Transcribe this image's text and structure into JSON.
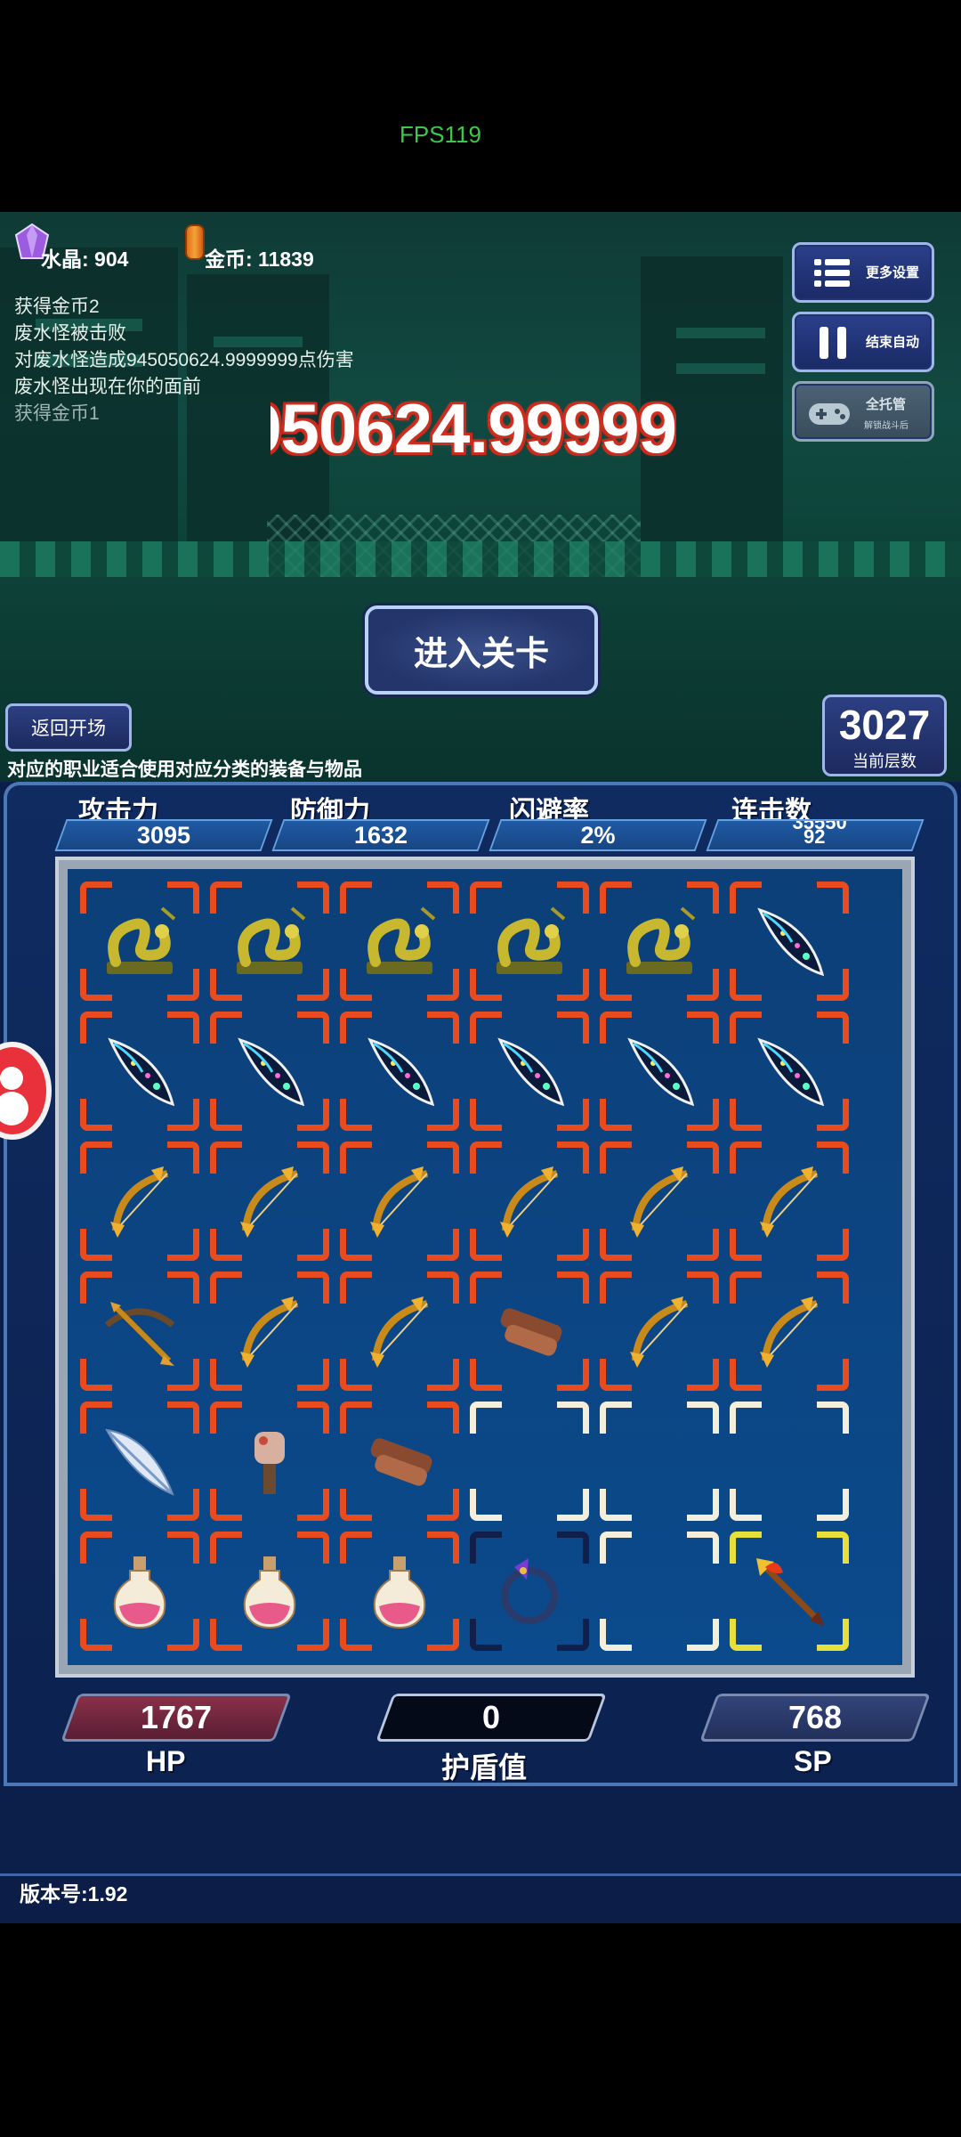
{
  "fps": "FPS119",
  "resources": {
    "crystal_label": "水晶: 904",
    "gold_label": "金币: 11839"
  },
  "battle_log": [
    "获得金币2",
    "废水怪被击败",
    "对废水怪造成945050624.9999999点伤害",
    "废水怪出现在你的面前",
    "获得金币1"
  ],
  "damage_popup": "950624.99999",
  "side_buttons": {
    "more_settings": "更多设置",
    "end_auto": "结束自动",
    "auto_play": "全托管",
    "auto_play_sub": "解锁战斗后"
  },
  "enter_level": "进入关卡",
  "back_to_start": "返回开场",
  "floor": {
    "value": "3027",
    "caption": "当前层数"
  },
  "hint": "对应的职业适合使用对应分类的装备与物品",
  "stats": {
    "attack": {
      "label": "攻击力",
      "value": "3095"
    },
    "defense": {
      "label": "防御力",
      "value": "1632"
    },
    "dodge": {
      "label": "闪避率",
      "value": "2%"
    },
    "combo": {
      "label": "连击数",
      "value_top": "35550",
      "value_bottom": "92"
    }
  },
  "inventory": [
    [
      "serpent",
      "serpent",
      "serpent",
      "serpent",
      "serpent",
      "feather-blade"
    ],
    [
      "feather-blade",
      "feather-blade",
      "feather-blade",
      "feather-blade",
      "feather-blade",
      "feather-blade"
    ],
    [
      "golden-bow",
      "golden-bow",
      "golden-bow",
      "golden-bow",
      "golden-bow",
      "golden-bow"
    ],
    [
      "crossbow",
      "golden-bow",
      "golden-bow",
      "leather-scroll",
      "golden-bow",
      "golden-bow"
    ],
    [
      "white-feather",
      "fist-item",
      "leather-scroll",
      "empty",
      "empty",
      "empty"
    ],
    [
      "potion",
      "potion",
      "potion",
      "dark-ring",
      "empty",
      "fire-arrow"
    ]
  ],
  "bars": {
    "hp": {
      "value": "1767",
      "label": "HP"
    },
    "shield": {
      "value": "0",
      "label": "护盾值"
    },
    "sp": {
      "value": "768",
      "label": "SP"
    }
  },
  "version": "版本号:1.92",
  "colors": {
    "frame_red": "#e84b1e",
    "panel_blue": "#0b4a8c",
    "accent": "#9fb6ea"
  }
}
